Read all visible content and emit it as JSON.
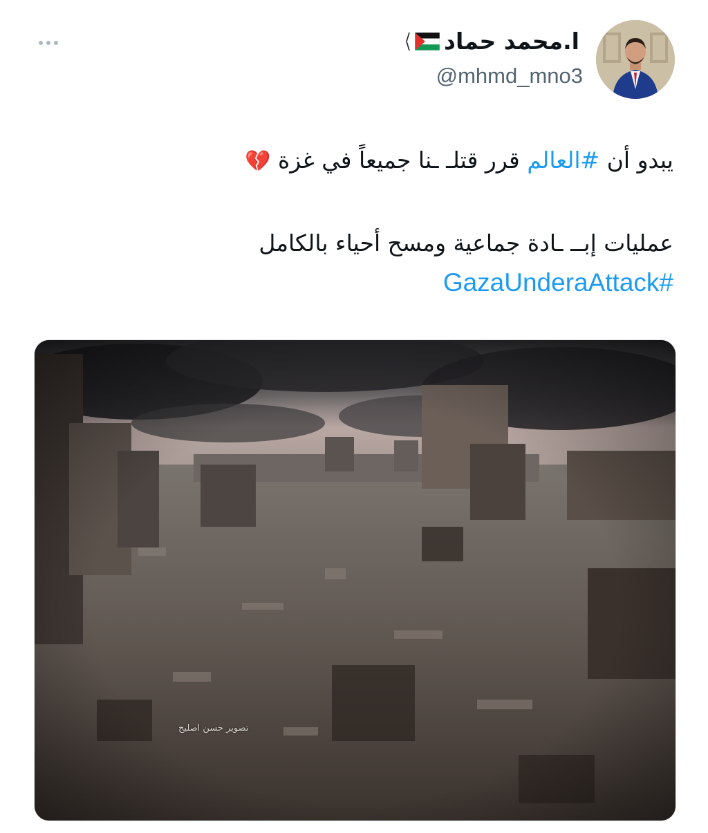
{
  "tweet": {
    "display_name": "ا.محمد حماد",
    "flag_icon": "palestine-flag-icon",
    "handle": "@mhmd_mno3",
    "more_icon": "more-horizontal-icon",
    "line1": {
      "before": "يبدو أن ",
      "hashtag": "#العالم",
      "after": " قرر قتلـ ـنا جميعاً في غزة ",
      "emoji": "💔"
    },
    "line2": "عمليات إبــ ـادة جماعية ومسح أحياء بالكامل",
    "hashtag2": "#GazaUnderaAttack",
    "media": {
      "watermark": "تصوير حسن اصليح"
    }
  },
  "colors": {
    "link": "#1d9bf0",
    "secondary_text": "#536471",
    "text": "#0f1419"
  }
}
